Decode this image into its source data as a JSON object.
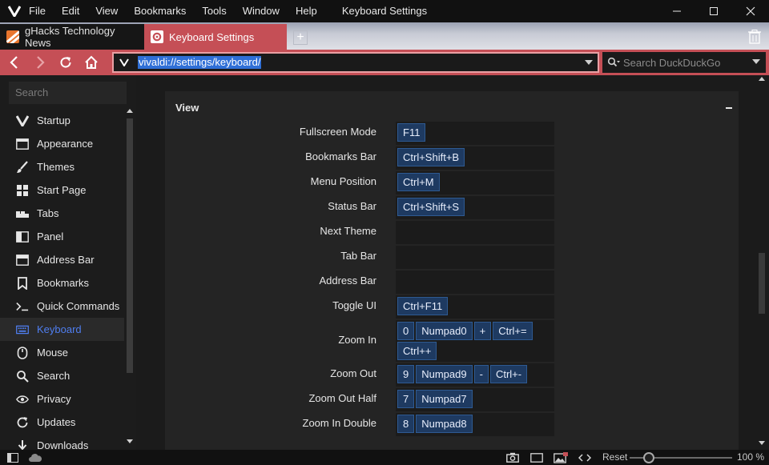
{
  "window": {
    "title": "Keyboard Settings",
    "menu": [
      "File",
      "Edit",
      "View",
      "Bookmarks",
      "Tools",
      "Window",
      "Help"
    ]
  },
  "tabs": [
    {
      "label": "gHacks Technology News",
      "icon": "ghacks-favicon"
    },
    {
      "label": "Keyboard Settings",
      "icon": "gear-icon",
      "active": true
    }
  ],
  "address": {
    "url": "vivaldi://settings/keyboard/",
    "search_placeholder": "Search DuckDuckGo"
  },
  "sidebar": {
    "search_placeholder": "Search",
    "items": [
      {
        "label": "Startup",
        "icon": "vivaldi-icon"
      },
      {
        "label": "Appearance",
        "icon": "window-icon"
      },
      {
        "label": "Themes",
        "icon": "brush-icon"
      },
      {
        "label": "Start Page",
        "icon": "grid-icon"
      },
      {
        "label": "Tabs",
        "icon": "tabs-icon"
      },
      {
        "label": "Panel",
        "icon": "panel-icon"
      },
      {
        "label": "Address Bar",
        "icon": "address-bar-icon"
      },
      {
        "label": "Bookmarks",
        "icon": "bookmark-icon"
      },
      {
        "label": "Quick Commands",
        "icon": "command-icon"
      },
      {
        "label": "Keyboard",
        "icon": "keyboard-icon",
        "active": true
      },
      {
        "label": "Mouse",
        "icon": "mouse-icon"
      },
      {
        "label": "Search",
        "icon": "search-icon"
      },
      {
        "label": "Privacy",
        "icon": "eye-icon"
      },
      {
        "label": "Updates",
        "icon": "updates-icon"
      },
      {
        "label": "Downloads",
        "icon": "download-icon"
      }
    ]
  },
  "section": {
    "title": "View",
    "rows": [
      {
        "label": "Fullscreen Mode",
        "keys": [
          "F11"
        ]
      },
      {
        "label": "Bookmarks Bar",
        "keys": [
          "Ctrl+Shift+B"
        ]
      },
      {
        "label": "Menu Position",
        "keys": [
          "Ctrl+M"
        ]
      },
      {
        "label": "Status Bar",
        "keys": [
          "Ctrl+Shift+S"
        ]
      },
      {
        "label": "Next Theme",
        "keys": []
      },
      {
        "label": "Tab Bar",
        "keys": []
      },
      {
        "label": "Address Bar",
        "keys": []
      },
      {
        "label": "Toggle UI",
        "keys": [
          "Ctrl+F11"
        ]
      },
      {
        "label": "Zoom In",
        "keys": [
          "0",
          "Numpad0",
          "+",
          "Ctrl+=",
          "Ctrl++"
        ],
        "tall": true
      },
      {
        "label": "Zoom Out",
        "keys": [
          "9",
          "Numpad9",
          "-",
          "Ctrl+-"
        ]
      },
      {
        "label": "Zoom Out Half",
        "keys": [
          "7",
          "Numpad7"
        ]
      },
      {
        "label": "Zoom In Double",
        "keys": [
          "8",
          "Numpad8"
        ]
      }
    ]
  },
  "status": {
    "reset_label": "Reset",
    "zoom": "100 %"
  },
  "colors": {
    "accent": "#c54f56",
    "key_bg": "#1e3a61",
    "active_item": "#4f7ef0"
  }
}
